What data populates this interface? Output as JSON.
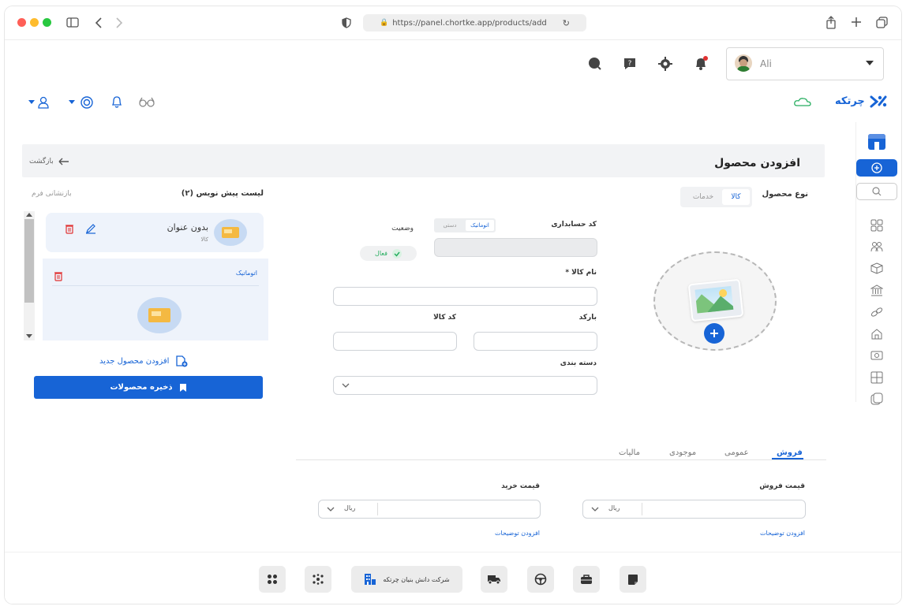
{
  "browser": {
    "url": "https://panel.chortke.app/products/add",
    "traffic_colors": [
      "#ff5f57",
      "#febc2e",
      "#28c840"
    ]
  },
  "topbar": {
    "account_name": "Ali",
    "icons": [
      "search-icon",
      "help-icon",
      "settings-icon",
      "notification-icon"
    ]
  },
  "appbar": {
    "brand": "چرتکه",
    "icons": [
      "user-dropdown-icon",
      "money-dropdown-icon",
      "bell-icon",
      "glasses-icon",
      "cloud-icon"
    ]
  },
  "page": {
    "title": "افزودن محصول",
    "back_label": "بازگشت"
  },
  "product_type": {
    "label": "نوع محصول",
    "options": [
      "کالا",
      "خدمات"
    ],
    "selected": "کالا"
  },
  "form": {
    "accounting_code_label": "کد حسابداری",
    "code_mode_options": [
      "اتوماتیک",
      "دستی"
    ],
    "code_mode_selected": "اتوماتیک",
    "status_label": "وضعیت",
    "status_value": "فعال",
    "product_name_label": "نام کالا *",
    "barcode_label": "بارکد",
    "product_code_label": "کد کالا",
    "category_label": "دسته بندی"
  },
  "drafts": {
    "list_title": "لیست پیش نویس (۲)",
    "reset_label": "بازنشانی فرم",
    "items": [
      {
        "title": "بدون عنوان",
        "type": "کالا"
      },
      {
        "title": "اتوماتیک"
      }
    ],
    "add_new_label": "افزودن محصول جدید",
    "save_label": "ذخیره محصولات"
  },
  "tabs": {
    "items": [
      "فروش",
      "عمومی",
      "موجودی",
      "مالیات"
    ],
    "active": "فروش"
  },
  "pricing": {
    "sale_price_label": "قیمت فروش",
    "purchase_price_label": "قیمت خرید",
    "currency": "ریال",
    "add_description_label": "افزودن توضیحات"
  },
  "dock": {
    "company_label": "شرکت دانش بنیان چرتکه"
  },
  "colors": {
    "primary": "#1764d6",
    "success": "#27ae60",
    "danger": "#e03131"
  }
}
